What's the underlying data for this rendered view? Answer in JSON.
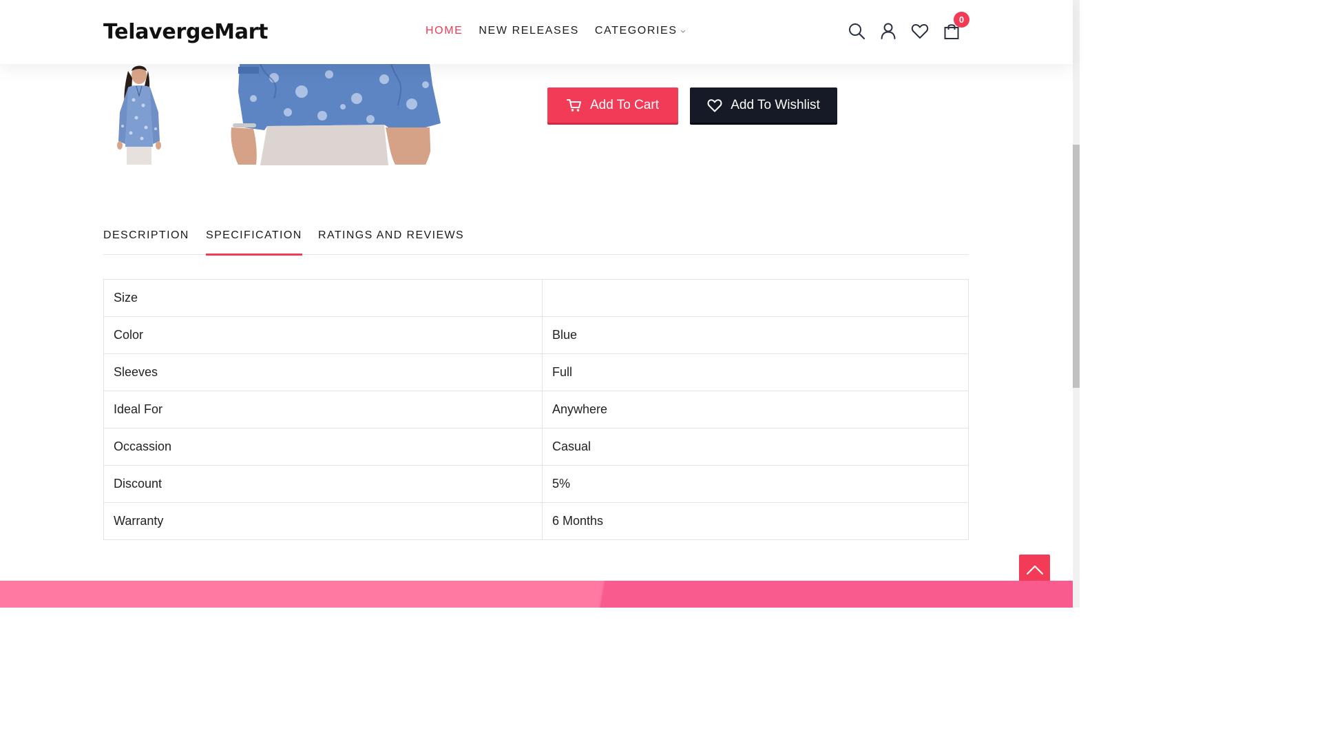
{
  "brand": {
    "name": "TelavergeMart",
    "accent": "#f23b56"
  },
  "nav": {
    "items": [
      {
        "label": "HOME",
        "active": true
      },
      {
        "label": "NEW RELEASES",
        "active": false
      },
      {
        "label": "CATEGORIES",
        "active": false,
        "has_dropdown": true
      }
    ]
  },
  "header_icons": [
    "search-icon",
    "user-icon",
    "heart-icon",
    "shopping-bag-icon"
  ],
  "cart": {
    "count": "0"
  },
  "product": {
    "add_to_cart_label": "Add To Cart",
    "add_to_wishlist_label": "Add To Wishlist"
  },
  "tabs": [
    {
      "label": "DESCRIPTION",
      "active": false
    },
    {
      "label": "SPECIFICATION",
      "active": true
    },
    {
      "label": "RATINGS AND REVIEWS",
      "active": false
    }
  ],
  "specs": [
    {
      "key": "Size",
      "value": ""
    },
    {
      "key": "Color",
      "value": "Blue"
    },
    {
      "key": "Sleeves",
      "value": "Full"
    },
    {
      "key": "Ideal For",
      "value": "Anywhere"
    },
    {
      "key": "Occassion",
      "value": "Casual"
    },
    {
      "key": "Discount",
      "value": "5%"
    },
    {
      "key": "Warranty",
      "value": "6 Months"
    }
  ]
}
